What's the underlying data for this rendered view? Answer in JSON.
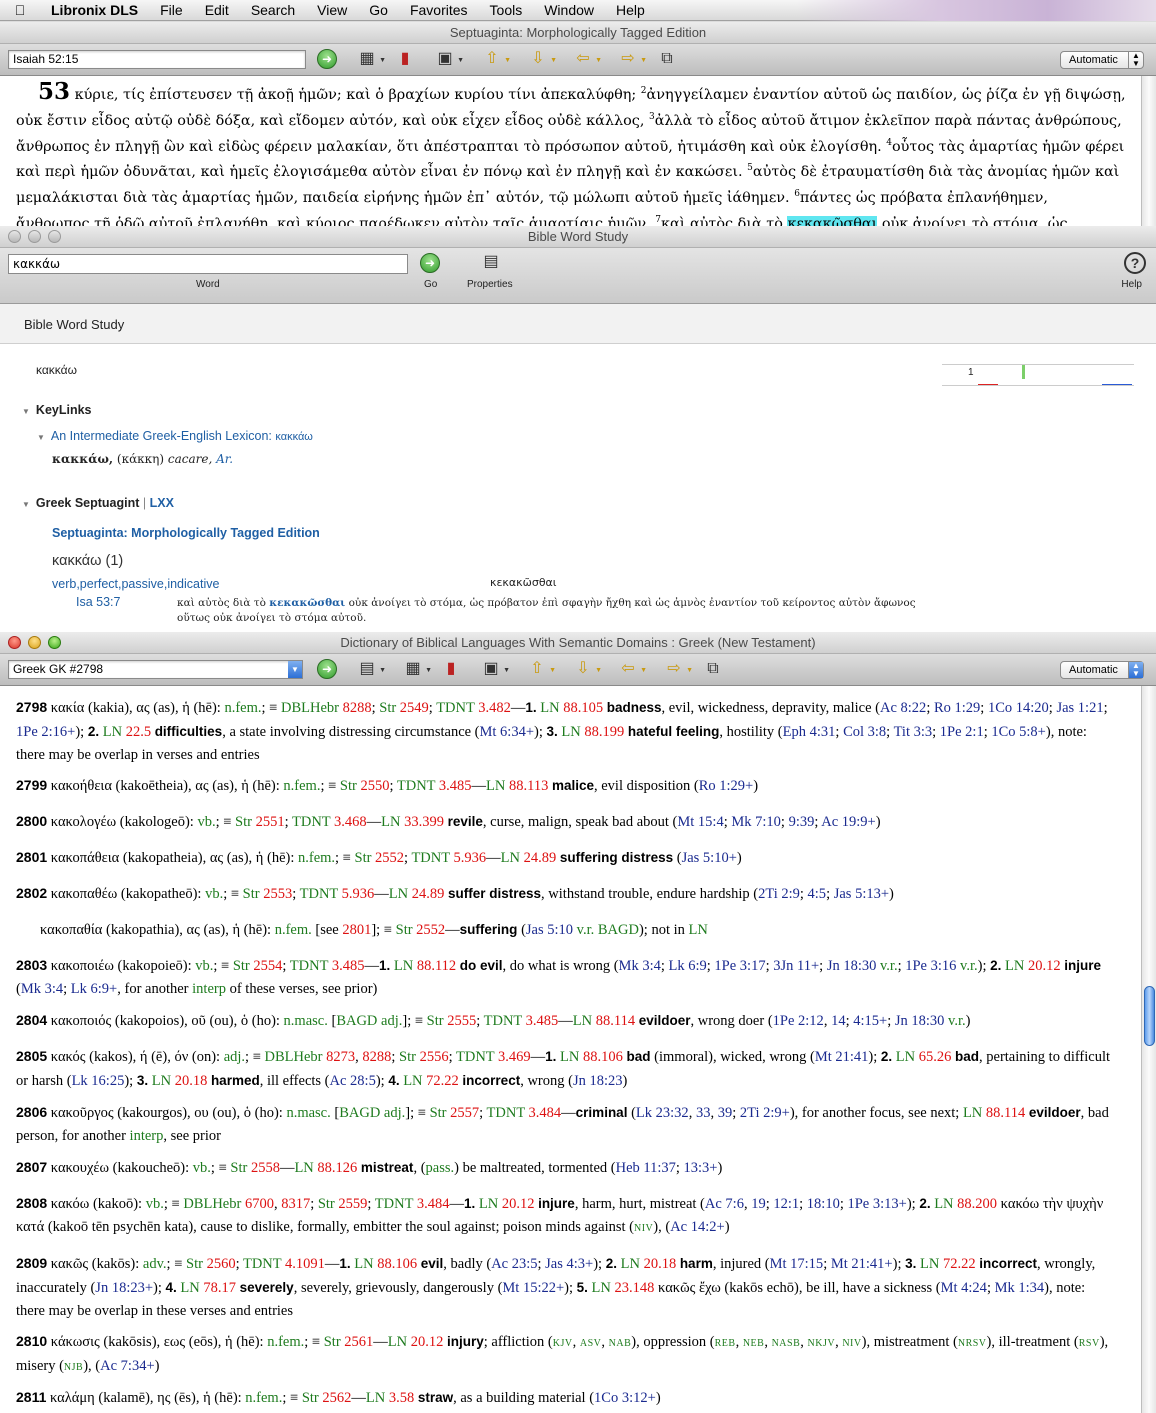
{
  "menubar": {
    "app": "Libronix DLS",
    "items": [
      "File",
      "Edit",
      "Search",
      "View",
      "Go",
      "Favorites",
      "Tools",
      "Window",
      "Help"
    ]
  },
  "win1": {
    "title": "Septuaginta: Morphologically Tagged Edition",
    "reference": "Isaiah 52:15",
    "layout_mode": "Automatic",
    "chapter": "53",
    "lines": [
      "κύριε, τίς ἐπίστευσεν τῇ ἀκοῇ ἡμῶν; καὶ ὁ βραχίων κυρίου τίνι ἀπεκαλύφθη;",
      "ἀνηγγείλαμεν ἐναντίον αὐτοῦ ὡς παιδίον, ὡς ῥίζα ἐν γῇ διψώσῃ, οὐκ ἔστιν εἶδος αὐτῷ οὐδὲ δόξα, καὶ εἴδομεν αὐτόν, καὶ οὐκ εἶχεν εἶδος οὐδὲ κάλλος,",
      "ἀλλὰ τὸ εἶδος αὐτοῦ ἄτιμον ἐκλεῖπον παρὰ πάντας ἀνθρώπους, ἄνθρωπος ἐν πληγῇ ὢν καὶ εἰδὼς φέρειν μαλακίαν, ὅτι ἀπέστραπται τὸ πρόσωπον αὐτοῦ, ἠτιμάσθη καὶ οὐκ ἐλογίσθη.",
      "οὗτος τὰς ἁμαρτίας ἡμῶν φέρει καὶ περὶ ἡμῶν ὀδυνᾶται, καὶ ἡμεῖς ἐλογισάμεθα αὐτὸν εἶναι ἐν πόνῳ καὶ ἐν πληγῇ καὶ ἐν κακώσει.",
      "αὐτὸς δὲ ἐτραυματίσθη διὰ τὰς ἀνομίας ἡμῶν καὶ μεμαλάκισται διὰ τὰς ἁμαρτίας ἡμῶν, παιδεία εἰρήνης ἡμῶν ἐπ᾽ αὐτόν, τῷ μώλωπι αὐτοῦ ἡμεῖς ἰάθημεν.",
      "πάντες ὡς πρόβατα ἐπλανήθημεν, ἄνθρωπος τῇ ὁδῷ αὐτοῦ ἐπλανήθη, καὶ κύριος παρέδωκεν αὐτὸν ταῖς ἁμαρτίαις ἡμῶν."
    ],
    "v7_pre": "καὶ αὐτὸς διὰ τὸ",
    "v7_hl": "κεκακῶσθαι",
    "v7_post": "οὐκ ἀνοίγει τὸ στόμα, ὡς πρόβατον ἐπὶ σφαγὴν ἤχθη καὶ ὡς ἀμνὸς ἐναντίον τοῦ κείροντος αὐτὸν ἄφωνος οὕτως οὐκ"
  },
  "win2": {
    "title": "Bible Word Study",
    "word": "κακκάω",
    "word_caption": "Word",
    "go_caption": "Go",
    "properties_caption": "Properties",
    "help_caption": "Help",
    "header": "Bible Word Study",
    "lemma": "κακκάω",
    "graph_count": "1",
    "keylinks": "KeyLinks",
    "lexicon_link": "An Intermediate Greek-English Lexicon:",
    "lexicon_lemma": "κακκάω",
    "lex_head": "κακκάω,",
    "lex_paren": "(κάκκη)",
    "lex_def": "cacare,",
    "lex_src": "Ar.",
    "sept_section": "Greek Septuagint",
    "sept_sep": "|",
    "lxx": "LXX",
    "edition": "Septuaginta: Morphologically Tagged Edition",
    "lemma_count": "κακκάω (1)",
    "morph": "verb,perfect,passive,indicative",
    "form": "κεκακῶσθαι",
    "ref": "Isa 53:7",
    "ctx_pre": "καὶ αὐτὸς διὰ τὸ",
    "ctx_hl": "κεκακῶσθαι",
    "ctx_post": "οὐκ ἀνοίγει τὸ στόμα, ὡς πρόβατον ἐπὶ σφαγὴν ἤχθη καὶ ὡς ἀμνὸς ἐναντίον τοῦ κείροντος αὐτὸν ἄφωνος",
    "ctx_line2": "οὕτως οὐκ ἀνοίγει τὸ στόμα αὐτοῦ."
  },
  "win3": {
    "title": "Dictionary of Biblical Languages With Semantic Domains : Greek (New Testament)",
    "reference": "Greek GK #2798",
    "layout_mode": "Automatic"
  },
  "colors": {
    "green": "#1e7b1e",
    "red": "#d11",
    "blue": "#1a2a8f",
    "link": "#1f5fa4",
    "highlight": "#5fe6f0"
  }
}
